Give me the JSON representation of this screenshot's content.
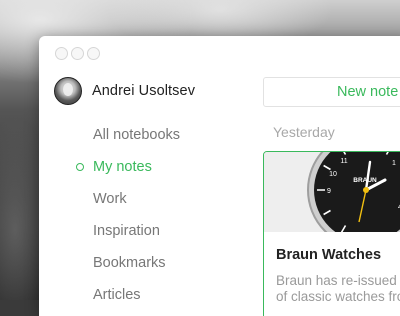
{
  "user": {
    "name": "Andrei Usoltsev"
  },
  "sidebar": {
    "items": [
      {
        "label": "All notebooks",
        "active": false
      },
      {
        "label": "My notes",
        "active": true
      },
      {
        "label": "Work",
        "active": false
      },
      {
        "label": "Inspiration",
        "active": false
      },
      {
        "label": "Bookmarks",
        "active": false
      },
      {
        "label": "Articles",
        "active": false
      }
    ]
  },
  "toolbar": {
    "new_note_label": "New note"
  },
  "notes_list": {
    "group_label": "Yesterday",
    "notes": [
      {
        "title": "Braun Watches",
        "excerpt_line1": "Braun has re-issued",
        "excerpt_line2": "of classic watches from",
        "image": "braun-watch-image",
        "watch_brand": "BRAUN"
      }
    ]
  },
  "colors": {
    "accent": "#3ab95c",
    "text": "#222222",
    "muted": "#777777"
  }
}
